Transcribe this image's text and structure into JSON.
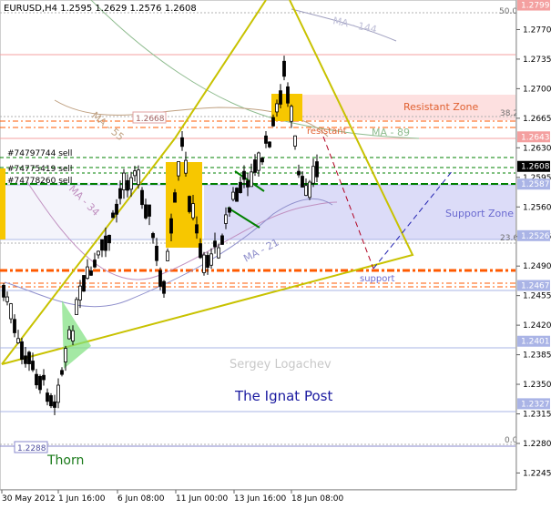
{
  "window": {
    "symbol_timeframe": "EURUSD,H4",
    "ohlc": "1.2595 1.2629 1.2576 1.2608"
  },
  "price_axis": {
    "ticks": [
      "1.2770",
      "1.2735",
      "1.2700",
      "1.2665",
      "1.2630",
      "1.2595",
      "1.2560",
      "1.2525",
      "1.2490",
      "1.2455",
      "1.2420",
      "1.2385",
      "1.2350",
      "1.2315",
      "1.2280",
      "1.2245"
    ],
    "current_price": "1.2608",
    "level_tags": [
      {
        "value": "1.2799",
        "color": "#f4a0a0"
      },
      {
        "value": "1.2643",
        "color": "#f4a0a0"
      },
      {
        "value": "1.2587",
        "color": "#aab4e6"
      },
      {
        "value": "1.2526",
        "color": "#aab4e6"
      },
      {
        "value": "1.2467",
        "color": "#aab4e6"
      },
      {
        "value": "1.2401",
        "color": "#aab4e6"
      },
      {
        "value": "1.2327",
        "color": "#aab4e6"
      }
    ]
  },
  "time_axis": {
    "labels": [
      "30 May 2012",
      "1 Jun 16:00",
      "6 Jun 08:00",
      "11 Jun 00:00",
      "13 Jun 16:00",
      "18 Jun 08:00"
    ]
  },
  "fibo": {
    "f50": "50.0",
    "f382": "38.2",
    "f236": "23.6",
    "f0": "0.0"
  },
  "orders": [
    "#74797744 sell",
    "#74775419 sell",
    "#74778260 sell"
  ],
  "ma_labels": {
    "ma144": "MA - 144",
    "ma89": "MA - 89",
    "ma55": "MA - 55",
    "ma34": "MA - 34",
    "ma21": "MA - 21"
  },
  "annotations": {
    "resistant_zone": "Resistant Zone",
    "support_zone": "Support Zone",
    "resistant": "resistant",
    "support": "support",
    "price_2668": "1.2668",
    "price_2288": "1.2288",
    "author": "Sergey Logachev",
    "publisher": "The Ignat Post",
    "thorn": "Thorn"
  },
  "colors": {
    "resistant_zone": "#fde0e0",
    "support_zone": "#dcdcf8",
    "triangle": "#c8c200",
    "order_line": "#008000",
    "pivot_orange": "#ff5a00",
    "highlight_bar": "#f7c700"
  }
}
